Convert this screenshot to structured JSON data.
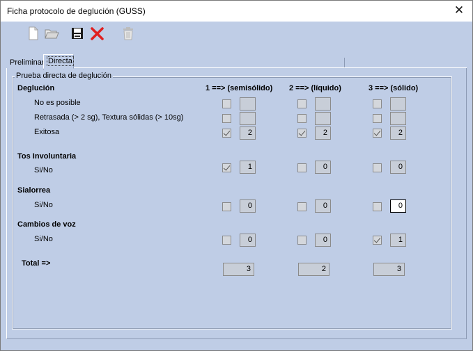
{
  "window": {
    "title": "Ficha protocolo de deglución (GUSS)"
  },
  "toolbar": {
    "buttons": [
      {
        "name": "new-document",
        "icon": "new-document-icon"
      },
      {
        "name": "open-folder",
        "icon": "open-folder-icon"
      },
      {
        "name": "save",
        "icon": "save-icon"
      },
      {
        "name": "cancel",
        "icon": "red-x-icon"
      },
      {
        "name": "delete",
        "icon": "trash-icon"
      }
    ]
  },
  "tabs": [
    {
      "label": "Preliminar",
      "selected": false
    },
    {
      "label": "Directa",
      "selected": true
    }
  ],
  "group": {
    "legend": "Prueba directa de deglución"
  },
  "columns": [
    "1 ==> (semisólido)",
    "2 ==> (líquido)",
    "3 ==> (sólido)"
  ],
  "sections": [
    {
      "title": "Deglución",
      "rows": [
        {
          "label": "No es posible",
          "values": [
            {
              "checked": false,
              "value": ""
            },
            {
              "checked": false,
              "value": ""
            },
            {
              "checked": false,
              "value": ""
            }
          ]
        },
        {
          "label": "Retrasada (> 2 sg), Textura sólidas (> 10sg)",
          "values": [
            {
              "checked": false,
              "value": ""
            },
            {
              "checked": false,
              "value": ""
            },
            {
              "checked": false,
              "value": ""
            }
          ]
        },
        {
          "label": "Exitosa",
          "values": [
            {
              "checked": true,
              "value": "2"
            },
            {
              "checked": true,
              "value": "2"
            },
            {
              "checked": true,
              "value": "2"
            }
          ]
        }
      ]
    },
    {
      "title": "Tos Involuntaria",
      "rows": [
        {
          "label": "Si/No",
          "values": [
            {
              "checked": true,
              "value": "1"
            },
            {
              "checked": false,
              "value": "0"
            },
            {
              "checked": false,
              "value": "0"
            }
          ]
        }
      ]
    },
    {
      "title": "Sialorrea",
      "rows": [
        {
          "label": "Si/No",
          "values": [
            {
              "checked": false,
              "value": "0"
            },
            {
              "checked": false,
              "value": "0"
            },
            {
              "checked": false,
              "value": "0"
            }
          ]
        }
      ]
    },
    {
      "title": "Cambios de voz",
      "rows": [
        {
          "label": "Si/No",
          "values": [
            {
              "checked": false,
              "value": "0"
            },
            {
              "checked": false,
              "value": "0"
            },
            {
              "checked": true,
              "value": "1"
            }
          ]
        }
      ]
    }
  ],
  "total": {
    "label": "Total =>",
    "values": [
      "3",
      "2",
      "3"
    ]
  },
  "colors": {
    "window_bg": "#bfcde6",
    "field_bg": "#c8ced8",
    "cancel_red": "#e02020"
  }
}
